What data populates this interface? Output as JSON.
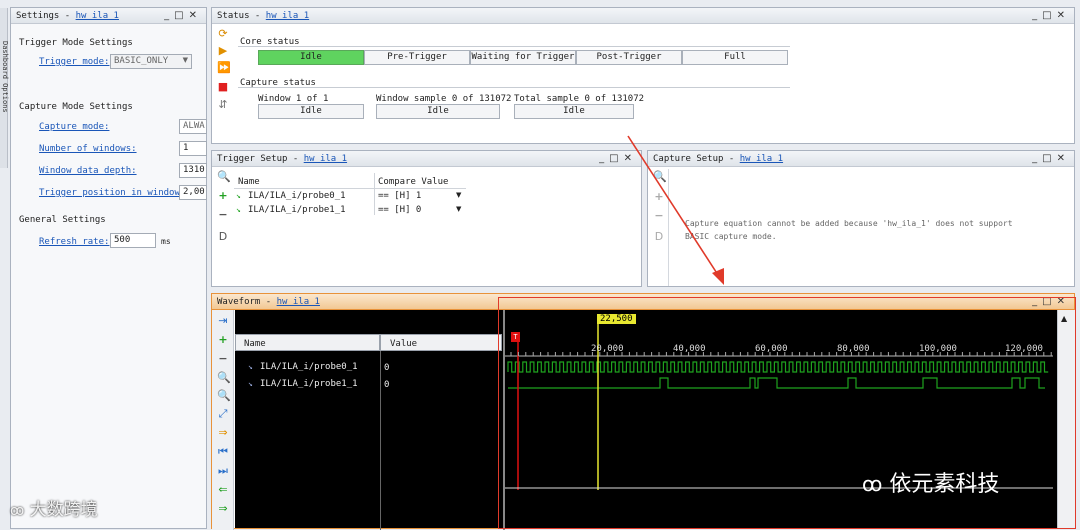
{
  "settings": {
    "title": "Settings - ",
    "link": "hw_ila_1",
    "side_tab": "Dashboard Options",
    "trigger_mode_section": "Trigger Mode Settings",
    "trigger_mode_label": "Trigger mode:",
    "trigger_mode_value": "BASIC_ONLY",
    "capture_mode_section": "Capture Mode Settings",
    "capture_mode_label": "Capture mode:",
    "capture_mode_value": "ALWA",
    "num_windows_label": "Number of windows:",
    "num_windows_value": "1",
    "window_depth_label": "Window data depth:",
    "window_depth_value": "1310",
    "trigger_pos_label": "Trigger position in window:",
    "trigger_pos_value": "2,00",
    "general_section": "General Settings",
    "refresh_label": "Refresh rate:",
    "refresh_value": "500",
    "refresh_unit": "ms"
  },
  "status": {
    "title": "Status - ",
    "link": "hw_ila_1",
    "core_status": "Core status",
    "core_cells": [
      "Idle",
      "Pre-Trigger",
      "Waiting for Trigger",
      "Post-Trigger",
      "Full"
    ],
    "capture_status": "Capture status",
    "window_label": "Window 1 of 1",
    "window_state": "Idle",
    "window_sample_label": "Window sample 0 of 131072",
    "window_sample_state": "Idle",
    "total_sample_label": "Total sample 0 of 131072",
    "total_sample_state": "Idle"
  },
  "trigger_setup": {
    "title": "Trigger Setup - ",
    "link": "hw_ila_1",
    "col_name": "Name",
    "col_compare": "Compare Value",
    "rows": [
      {
        "name": "ILA/ILA_i/probe0_1",
        "value": "== [H] 1"
      },
      {
        "name": "ILA/ILA_i/probe1_1",
        "value": "== [H] 0"
      }
    ]
  },
  "capture_setup": {
    "title": "Capture Setup - ",
    "link": "hw_ila_1",
    "message_line1": "Capture equation cannot be added because 'hw_ila_1' does not support",
    "message_line2": "BASIC capture mode."
  },
  "waveform": {
    "title": "Waveform - ",
    "link": "hw_ila_1",
    "col_name": "Name",
    "col_value": "Value",
    "signals": [
      {
        "name": "ILA/ILA_i/probe0_1",
        "value": "0"
      },
      {
        "name": "ILA/ILA_i/probe1_1",
        "value": "0"
      }
    ],
    "cursor_label": "22,500",
    "trigger_marker": "T",
    "ticks": [
      "20,000",
      "40,000",
      "60,000",
      "80,000",
      "100,000",
      "120,000"
    ]
  },
  "watermarks": {
    "left": "大数跨境",
    "right": "依元素科技"
  },
  "colors": {
    "idle_green": "#5fd35f",
    "wave_green": "#1fa31f",
    "cursor_yellow": "#e8e830",
    "trigger_red": "#e01010",
    "link_blue": "#1a56b8"
  }
}
